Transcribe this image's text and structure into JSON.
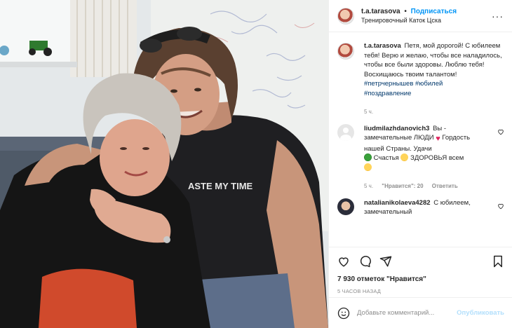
{
  "colors": {
    "accent": "#0095f6",
    "hashtag": "#00376b",
    "muted": "#8e8e8e",
    "heart": "#e0245e"
  },
  "header": {
    "username": "t.a.tarasova",
    "follow_label": "Подписаться",
    "location": "Тренировочный Каток Цска",
    "more_icon": "more-horizontal-icon"
  },
  "caption": {
    "username": "t.a.tarasova",
    "text": "Петя, мой дорогой! С юбилеем тебя! Верю и желаю, чтобы все наладилось, чтобы все были здоровы. Люблю тебя! Восхищаюсь твоим талантом!",
    "hashtags": [
      "#петрчернышев",
      "#юбилей",
      "#поздравление"
    ],
    "time": "5 ч."
  },
  "comments": [
    {
      "username": "liudmilazhdanovich3",
      "text_a": "Вы - замечательные ЛЮДИ",
      "text_b": "Гордость нашей Страны. Удачи",
      "text_c": "Счастья",
      "text_d": "ЗДОРОВЬЯ всем",
      "time": "5 ч.",
      "likes": "\"Нравится\": 20",
      "reply": "Ответить"
    },
    {
      "username": "natalianikolaeva4282",
      "text": "С юбилеем, замечательный"
    }
  ],
  "actions": {
    "likes": "7 930 отметок \"Нравится\"",
    "ago": "5 ЧАСОВ НАЗАД"
  },
  "photo": {
    "shirt_text": "ASTE MY TIME"
  },
  "add_comment": {
    "placeholder": "Добавьте комментарий...",
    "post_label": "Опубликовать"
  }
}
